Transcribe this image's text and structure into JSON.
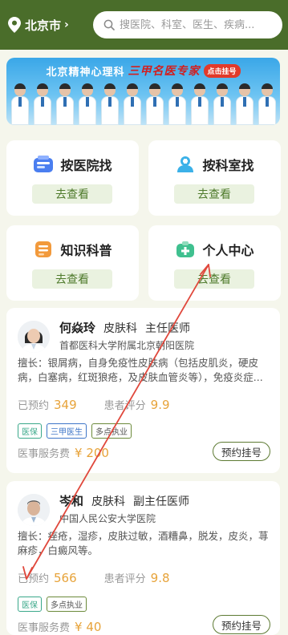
{
  "header": {
    "city": "北京市",
    "search_placeholder": "搜医院、科室、医生、疾病..."
  },
  "banner": {
    "title_left": "北京精神心理科",
    "title_mid": "三甲名医专家",
    "title_btn": "点击挂号"
  },
  "nav": [
    {
      "label": "按医院找",
      "button": "去查看",
      "icon": "hospital-icon"
    },
    {
      "label": "按科室找",
      "button": "去查看",
      "icon": "department-icon"
    },
    {
      "label": "知识科普",
      "button": "去查看",
      "icon": "book-icon"
    },
    {
      "label": "个人中心",
      "button": "去查看",
      "icon": "medical-kit-icon"
    }
  ],
  "doctors": [
    {
      "name": "何焱玲",
      "dept": "皮肤科",
      "title": "主任医师",
      "hospital": "首都医科大学附属北京朝阳医院",
      "specialty": "擅长：银屑病，自身免疫性皮肤病（包括皮肌炎，硬皮病，白塞病，红斑狼疮，及皮肤血管炎等），免疫炎症...",
      "booked_label": "已预约",
      "booked": "349",
      "rating_label": "患者评分",
      "rating": "9.9",
      "tags": [
        "医保",
        "三甲医生",
        "多点执业"
      ],
      "fee_label": "医事服务费",
      "fee": "¥ 200",
      "book_btn": "预约挂号"
    },
    {
      "name": "岑和",
      "dept": "皮肤科",
      "title": "副主任医师",
      "hospital": "中国人民公安大学医院",
      "specialty": "擅长：痤疮，湿疹，皮肤过敏，酒糟鼻，脱发，皮炎，荨麻疹，白癜风等。",
      "booked_label": "已预约",
      "booked": "566",
      "rating_label": "患者评分",
      "rating": "9.8",
      "tags": [
        "医保",
        "多点执业"
      ],
      "fee_label": "医事服务费",
      "fee": "¥ 40",
      "book_btn": "预约挂号"
    }
  ],
  "colors": {
    "header": "#4a6d2a",
    "accent": "#4e7a2b",
    "price": "#e7a33a",
    "arrow": "#e0483c"
  }
}
